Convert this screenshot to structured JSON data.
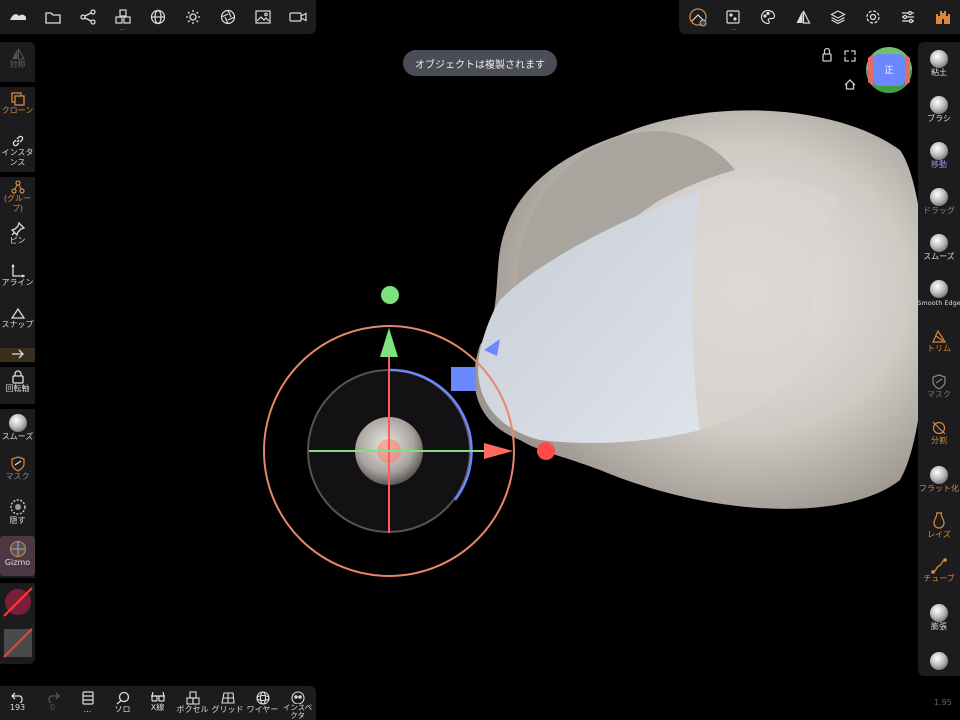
{
  "toast": "オブジェクトは複製されます",
  "version": "1.95",
  "view_cube_label": "正",
  "left_panel": {
    "symmetry": "対称",
    "clone": "クローン",
    "instance": "インスタンス",
    "group": "(グループ)",
    "pin": "ピン",
    "align": "アライン",
    "snap": "スナップ",
    "rotation_axis": "回転軸",
    "smooth": "スムーズ",
    "mask": "マスク",
    "hide": "隠す",
    "gizmo": "Gizmo"
  },
  "right_panel": {
    "clay": "粘土",
    "brush": "ブラシ",
    "move": "移動",
    "drag": "ドラッグ",
    "smooth": "スムーズ",
    "smooth_edge": "Smooth Edge",
    "trim": "トリム",
    "mask": "マスク",
    "split": "分割",
    "flatten": "フラット化",
    "layer": "レイズ",
    "tube": "チューブ",
    "inflate": "膨張"
  },
  "bottom_bar": {
    "undo_count": "193",
    "redo_count": "0",
    "more": "...",
    "solo": "ソロ",
    "xray": "X線",
    "voxel": "ボクセル",
    "grid": "グリッド",
    "wireframe": "ワイヤー",
    "inspector": "インスペクタ"
  },
  "colors": {
    "accent_orange": "#d9893a",
    "panel_bg": "#1c1c1e",
    "gizmo_red": "#ff5a5a",
    "gizmo_green": "#7fe07f",
    "gizmo_blue": "#6c88ff",
    "gizmo_ring_orange": "#e8866a"
  }
}
